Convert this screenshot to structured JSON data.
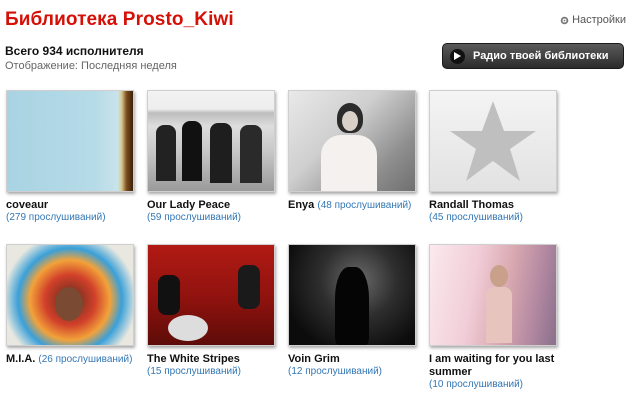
{
  "header": {
    "title": "Библиотека Prosto_Kiwi",
    "settings_label": "Настройки"
  },
  "summary": {
    "total": "Всего 934 исполнителя",
    "display": "Отображение: Последняя неделя"
  },
  "radio_button": {
    "label": "Радио твоей библиотеки"
  },
  "artists": [
    {
      "name": "coveaur",
      "plays": "(279 прослушиваний)"
    },
    {
      "name": "Our Lady Peace",
      "plays": "(59 прослушиваний)"
    },
    {
      "name": "Enya",
      "plays": "(48 прослушиваний)"
    },
    {
      "name": "Randall Thomas",
      "plays": "(45 прослушиваний)"
    },
    {
      "name": "M.I.A.",
      "plays": "(26 прослушиваний)"
    },
    {
      "name": "The White Stripes",
      "plays": "(15 прослушиваний)"
    },
    {
      "name": "Voin Grim",
      "plays": "(12 прослушиваний)"
    },
    {
      "name": "I am waiting for you last summer",
      "plays": "(10 прослушиваний)"
    }
  ]
}
